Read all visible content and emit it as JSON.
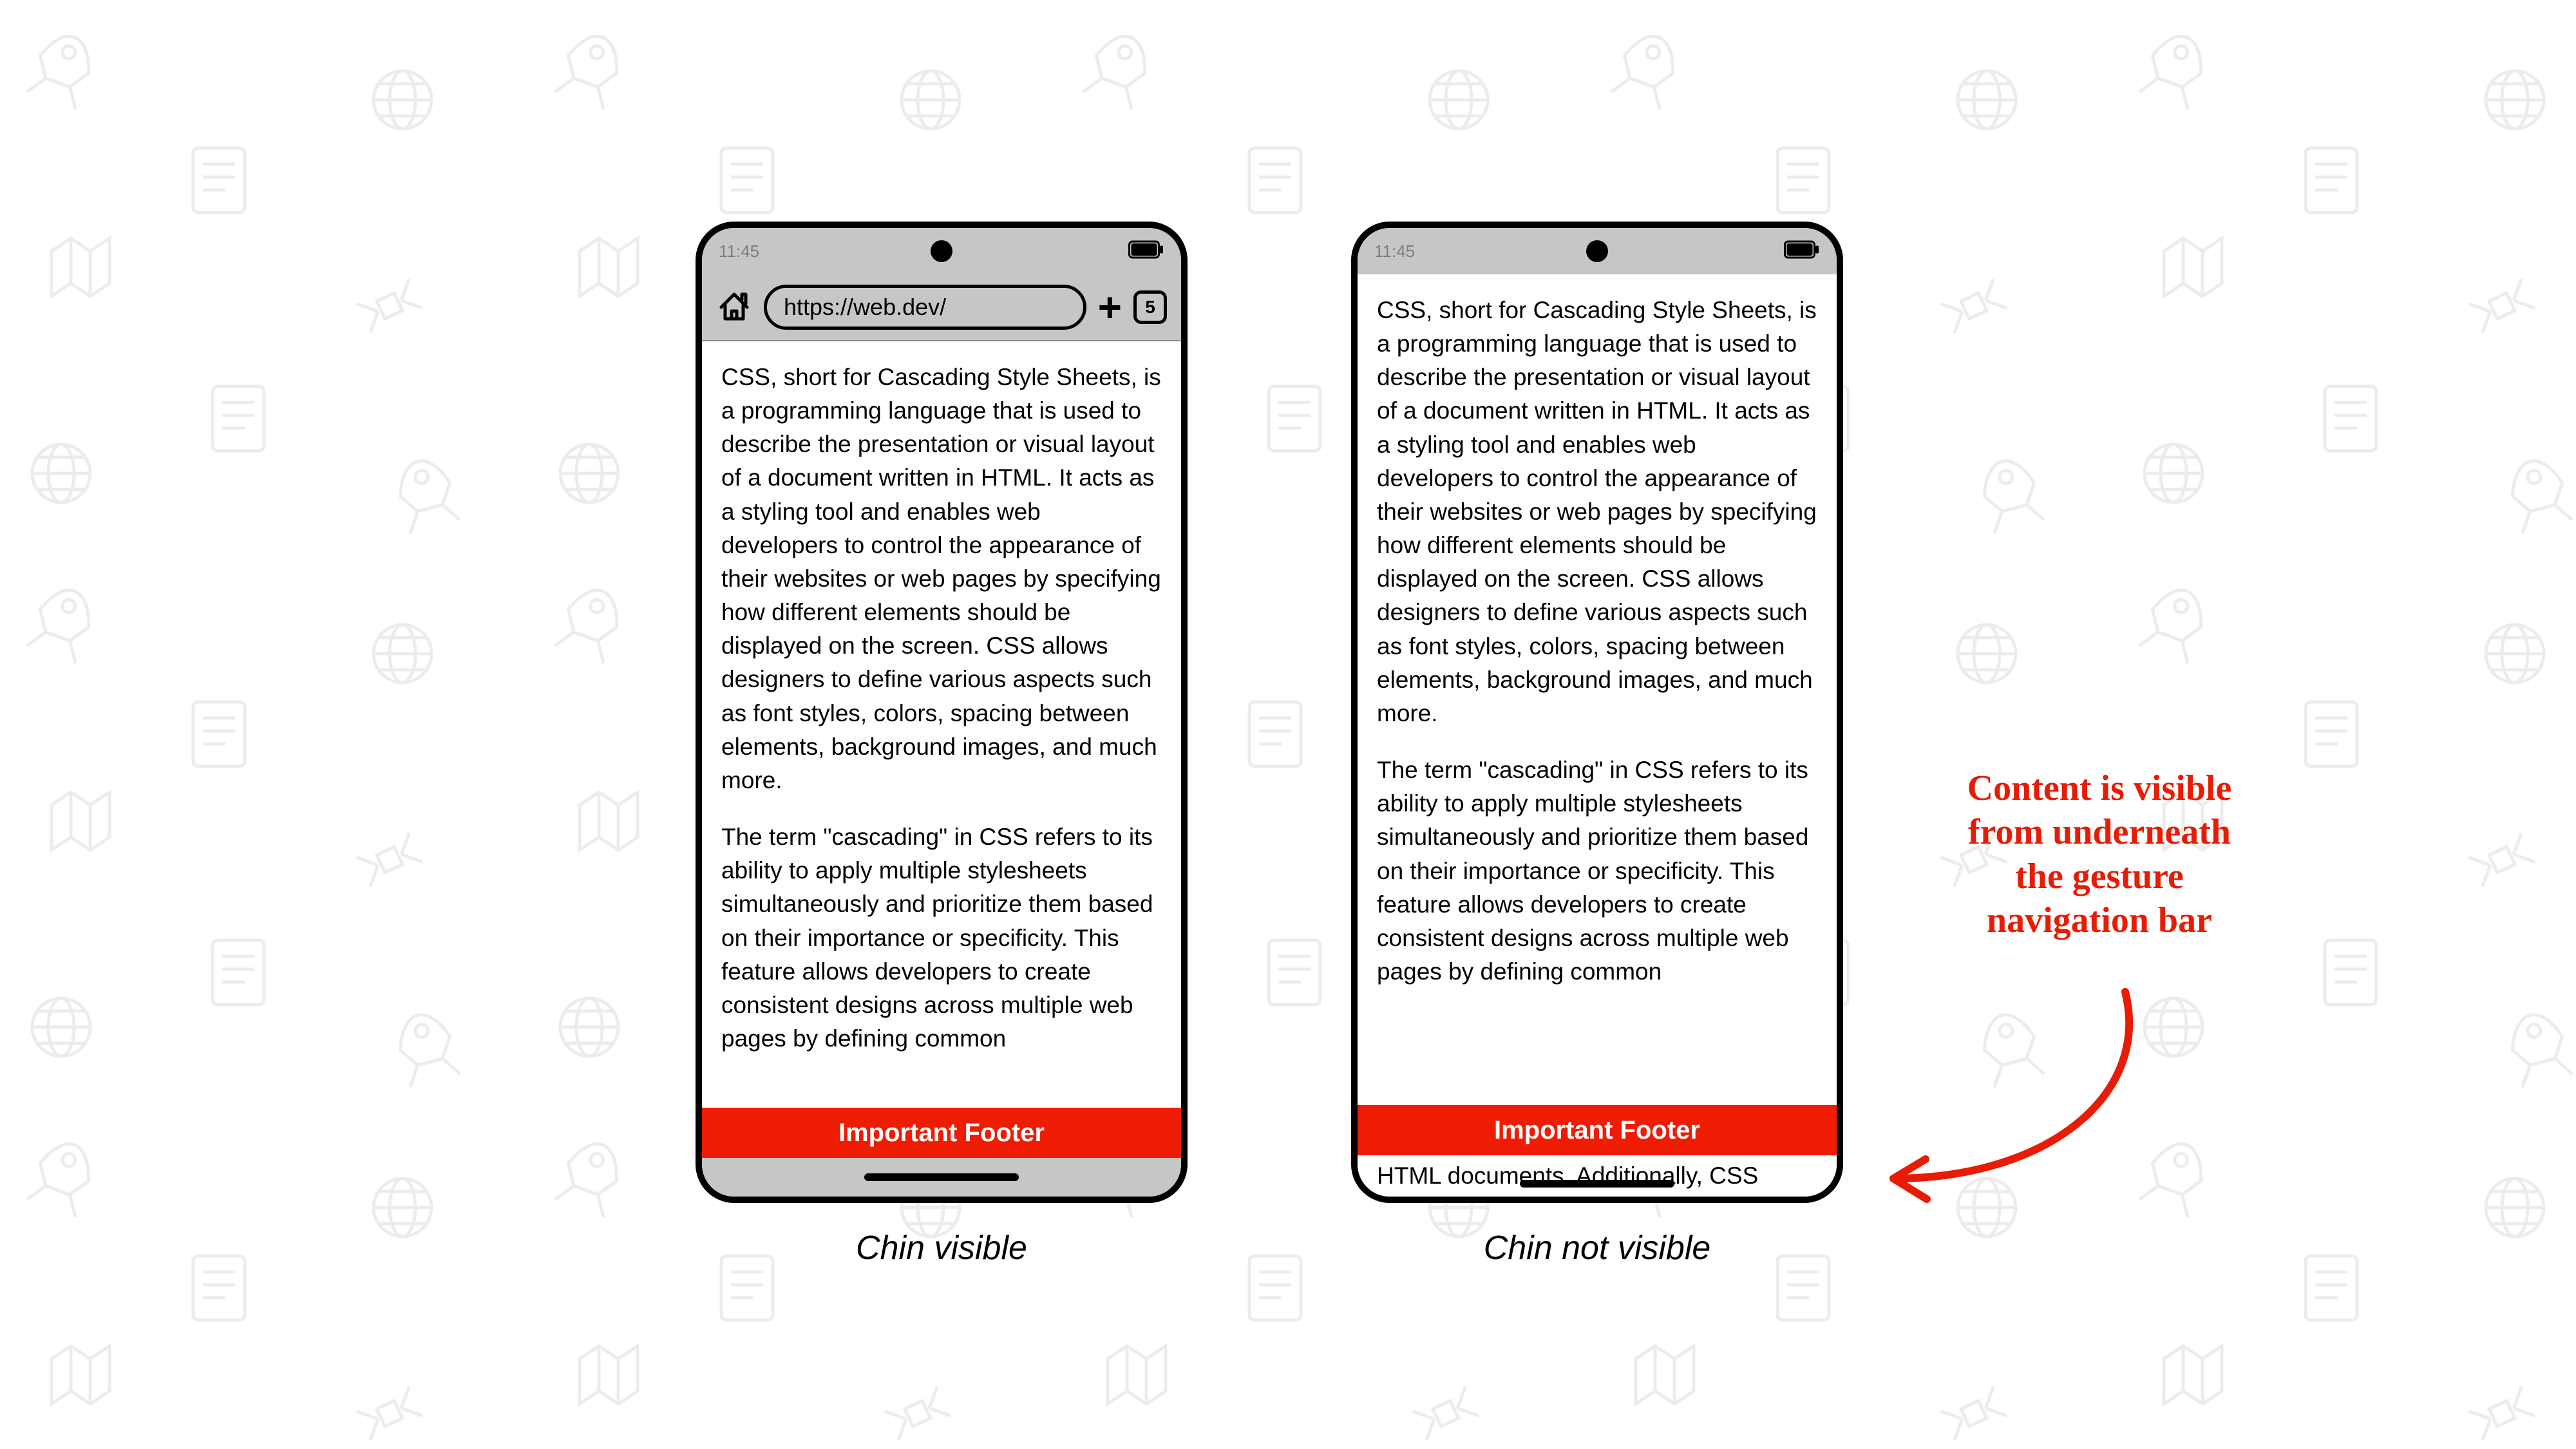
{
  "status": {
    "time": "11:45"
  },
  "browser": {
    "url": "https://web.dev/",
    "tab_count": "5"
  },
  "content": {
    "p1": "CSS, short for Cascading Style Sheets, is a programming language that is used to describe the presentation or visual layout of a document written in HTML. It acts as a styling tool and enables web developers to control the appearance of their websites or web pages by specifying how different elements should be displayed on the screen. CSS allows designers to define various aspects such as font styles, colors, spacing between elements, background images, and much more.",
    "p2": "The term \"cascading\" in CSS refers to its ability to apply multiple stylesheets simultaneously and prioritize them based on their importance or specificity. This feature allows developers to create consistent designs across multiple web pages by defining common",
    "below_footer": "HTML documents. Additionally, CSS"
  },
  "footer": {
    "label": "Important Footer"
  },
  "captions": {
    "left": "Chin visible",
    "right": "Chin not visible"
  },
  "annotation": {
    "line1": "Content is visible",
    "line2": "from underneath",
    "line3": "the gesture",
    "line4": "navigation bar"
  }
}
